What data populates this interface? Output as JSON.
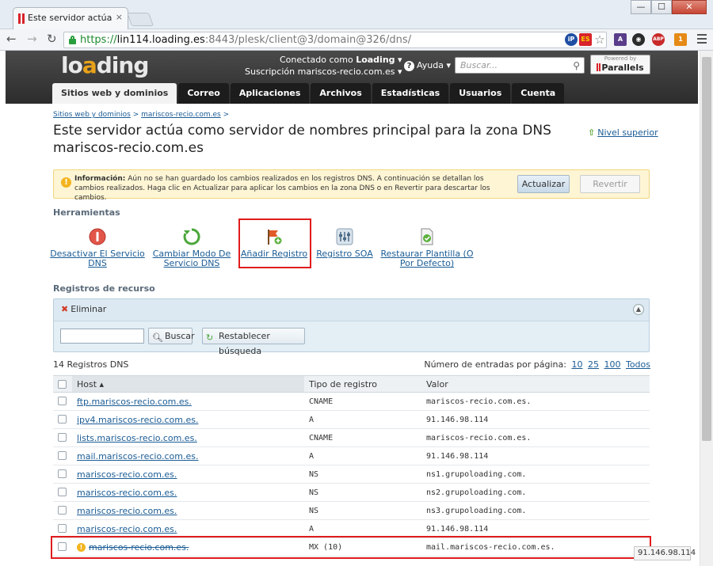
{
  "browser": {
    "tab_title": "Este servidor actúa como servidor de nombres principal",
    "tab_close": "×",
    "url_scheme": "https://",
    "url_host": "lin114.loading.es",
    "url_path": ":8443/plesk/client@3/domain@326/dns/",
    "window_minimize": "—",
    "window_maximize": "☐",
    "window_close": "✕",
    "extensions": [
      "iP",
      "ES",
      "☆",
      "A",
      "◉",
      "ABP",
      "1"
    ],
    "status_text": "91.146.98.114"
  },
  "header": {
    "logo_prefix": "lo",
    "logo_accent": "a",
    "logo_suffix": "ding",
    "connected_label": "Conectado como",
    "connected_user": "Loading",
    "subscription_label": "Suscripción",
    "subscription_value": "mariscos-recio.com.es",
    "help_label": "Ayuda",
    "search_placeholder": "Buscar...",
    "powered_by": "Powered by",
    "parallels": "Parallels"
  },
  "nav_tabs": [
    "Sitios web y dominios",
    "Correo",
    "Aplicaciones",
    "Archivos",
    "Estadísticas",
    "Usuarios",
    "Cuenta"
  ],
  "breadcrumb": [
    "Sitios web y dominios",
    "mariscos-recio.com.es"
  ],
  "page": {
    "title": "Este servidor actúa como servidor de nombres principal para la zona DNS mariscos-recio.com.es",
    "up_level": "Nivel superior"
  },
  "info_message": {
    "label": "Información:",
    "text": "Aún no se han guardado los cambios realizados en los registros DNS. A continuación se detallan los cambios realizados. Haga clic en Actualizar para aplicar los cambios en la zona DNS o en Revertir para descartar los cambios.",
    "update_button": "Actualizar",
    "revert_button": "Revertir"
  },
  "tools": {
    "title": "Herramientas",
    "items": [
      "Desactivar El Servicio DNS",
      "Cambiar Modo De Servicio DNS",
      "Añadir Registro",
      "Registro SOA",
      "Restaurar Plantilla (O Por Defecto)"
    ]
  },
  "records": {
    "title": "Registros de recurso",
    "delete_label": "Eliminar",
    "search_button": "Buscar",
    "reset_button": "Restablecer búsqueda",
    "count_text": "14 Registros DNS",
    "per_page_label": "Número de entradas por página:",
    "per_page_options": [
      "10",
      "25",
      "100",
      "Todos"
    ],
    "columns": [
      "Host",
      "Tipo de registro",
      "Valor"
    ],
    "rows": [
      {
        "host": "ftp.mariscos-recio.com.es.",
        "type": "CNAME",
        "value": "mariscos-recio.com.es."
      },
      {
        "host": "ipv4.mariscos-recio.com.es.",
        "type": "A",
        "value": "91.146.98.114"
      },
      {
        "host": "lists.mariscos-recio.com.es.",
        "type": "CNAME",
        "value": "mariscos-recio.com.es."
      },
      {
        "host": "mail.mariscos-recio.com.es.",
        "type": "A",
        "value": "91.146.98.114"
      },
      {
        "host": "mariscos-recio.com.es.",
        "type": "NS",
        "value": "ns1.grupoloading.com."
      },
      {
        "host": "mariscos-recio.com.es.",
        "type": "NS",
        "value": "ns2.grupoloading.com."
      },
      {
        "host": "mariscos-recio.com.es.",
        "type": "NS",
        "value": "ns3.grupoloading.com."
      },
      {
        "host": "mariscos-recio.com.es.",
        "type": "A",
        "value": "91.146.98.114"
      },
      {
        "host": "mariscos-recio.com.es.",
        "type": "MX (10)",
        "value": "mail.mariscos-recio.com.es.",
        "pending_delete": true
      }
    ]
  },
  "colors": {
    "accent_link": "#1b5c95",
    "highlight": "#e01c1c",
    "header_bg": "#3a3a3a",
    "info_bg": "#fdf5d4"
  }
}
